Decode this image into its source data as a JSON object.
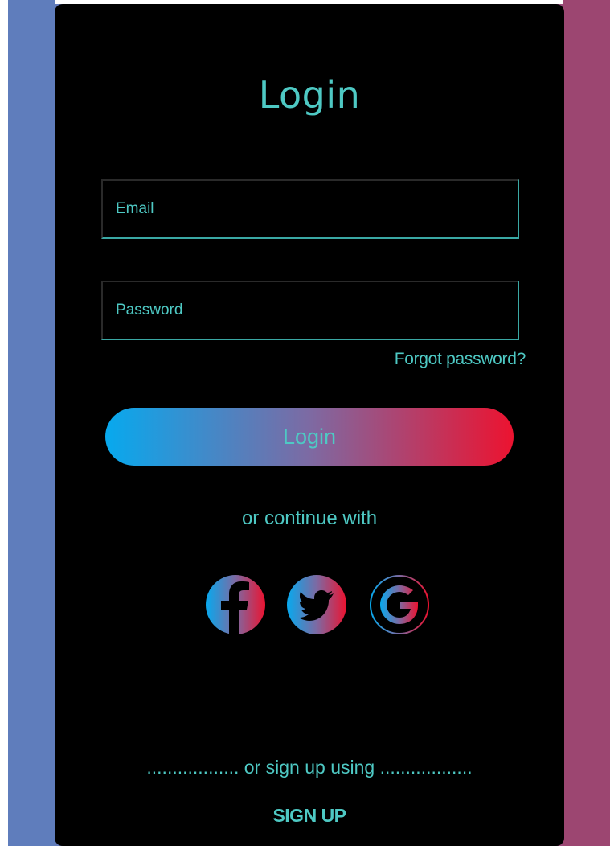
{
  "colors": {
    "accent": "#4ec9c4",
    "card_background": "#000000",
    "page_left": "#5f7dbc",
    "page_right": "#9c4671",
    "gradient_start": "#07a9ee",
    "gradient_end": "#ec1330"
  },
  "form": {
    "title": "Login",
    "email_placeholder": "Email",
    "email_value": "",
    "password_placeholder": "Password",
    "password_value": "",
    "forgot_password": "Forgot password?",
    "submit_label": "Login"
  },
  "social": {
    "caption": "or continue with",
    "icons": [
      "facebook-icon",
      "twitter-icon",
      "google-icon"
    ]
  },
  "signup": {
    "caption": ".................. or sign up using ..................",
    "button_label": "SIGN UP"
  }
}
